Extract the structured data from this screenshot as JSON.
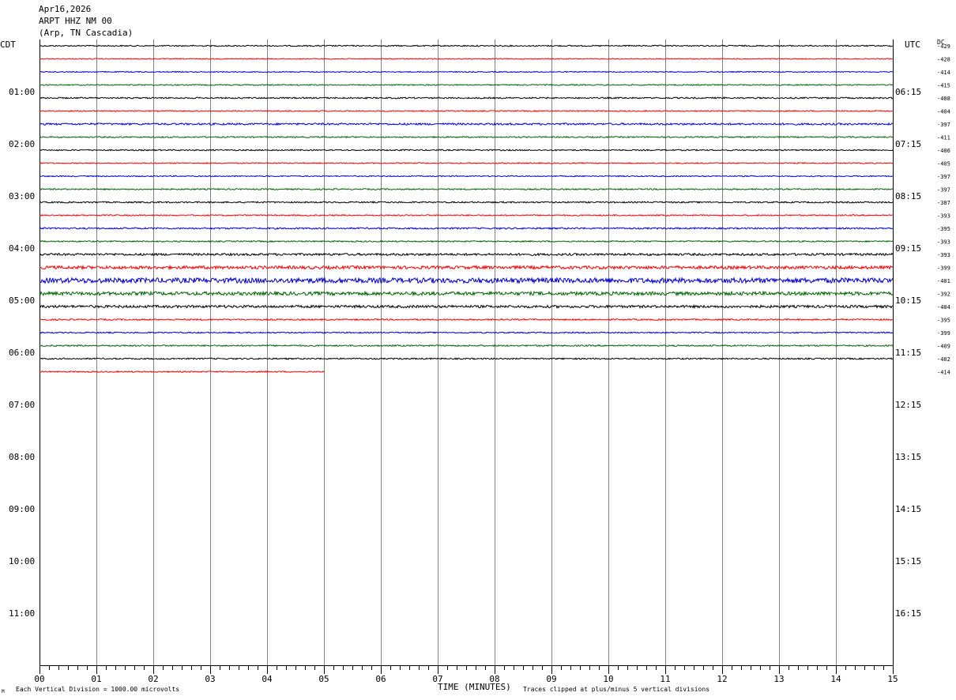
{
  "header": {
    "date": "Apr16,2026",
    "station": "ARPT HHZ NM 00",
    "location": "(Arp, TN Cascadia)"
  },
  "timezones": {
    "left": "CDT",
    "right": "UTC"
  },
  "dc_label": "DC",
  "footer": {
    "scale_note": "Each Vertical Division = 1000.00 microvolts",
    "xlabel": "TIME (MINUTES)",
    "clip_note": "Traces clipped at plus/minus 5 vertical divisions",
    "corner_mark": "M"
  },
  "colors": {
    "trace_cycle": [
      "#000000",
      "#ff0000",
      "#0000cc",
      "#006400"
    ],
    "grid": "#808080"
  },
  "chart_data": {
    "type": "line",
    "title": "ARPT HHZ NM 00",
    "xlabel": "TIME (MINUTES)",
    "ylabel": "",
    "xlim": [
      0,
      15
    ],
    "x_ticks": [
      "00",
      "01",
      "02",
      "03",
      "04",
      "05",
      "06",
      "07",
      "08",
      "09",
      "10",
      "11",
      "12",
      "13",
      "14",
      "15"
    ],
    "rows_total": 48,
    "left_hour_labels": [
      "01:00",
      "02:00",
      "03:00",
      "04:00",
      "05:00",
      "06:00",
      "07:00",
      "08:00",
      "09:00",
      "10:00",
      "11:00"
    ],
    "right_hour_labels": [
      "06:15",
      "07:15",
      "08:15",
      "09:15",
      "10:15",
      "11:15",
      "12:15",
      "13:15",
      "14:15",
      "15:15",
      "16:15"
    ],
    "dc_offsets": [
      "-429",
      "-428",
      "-414",
      "-415",
      "-408",
      "-404",
      "-397",
      "-411",
      "-406",
      "-405",
      "-397",
      "-397",
      "-387",
      "-393",
      "-395",
      "-393",
      "-393",
      "-399",
      "-401",
      "-392",
      "-404",
      "-395",
      "-399",
      "-409",
      "-402",
      "-414"
    ],
    "trace_noise": [
      0.8,
      0.6,
      0.6,
      0.7,
      0.9,
      0.7,
      1.2,
      0.8,
      0.8,
      0.7,
      0.7,
      0.8,
      0.9,
      0.8,
      1.0,
      0.8,
      1.4,
      2.0,
      3.2,
      2.2,
      1.6,
      0.9,
      0.8,
      0.9,
      0.9,
      0.8
    ],
    "last_trace_end_minute": 5.0
  }
}
